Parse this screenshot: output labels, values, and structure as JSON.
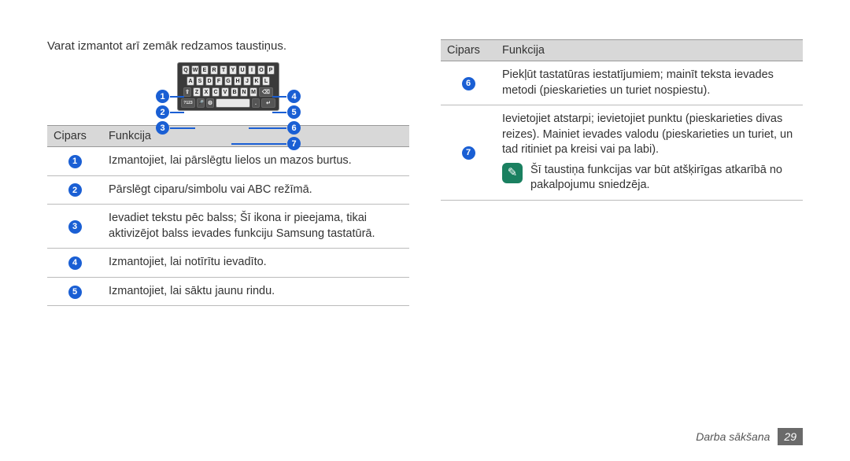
{
  "intro": "Varat izmantot arī zemāk redzamos taustiņus.",
  "headers": {
    "num": "Cipars",
    "func": "Funkcija"
  },
  "left_rows": [
    {
      "n": "1",
      "text": "Izmantojiet, lai pārslēgtu lielos un mazos burtus."
    },
    {
      "n": "2",
      "text": "Pārslēgt ciparu/simbolu vai ABC režīmā."
    },
    {
      "n": "3",
      "text": "Ievadiet tekstu pēc balss; Šī ikona ir pieejama, tikai aktivizējot balss ievades funkciju Samsung tastatūrā."
    },
    {
      "n": "4",
      "text": "Izmantojiet, lai notīrītu ievadīto."
    },
    {
      "n": "5",
      "text": "Izmantojiet, lai sāktu jaunu rindu."
    }
  ],
  "right_rows": [
    {
      "n": "6",
      "text": "Piekļūt tastatūras iestatījumiem; mainīt teksta ievades metodi (pieskarieties un turiet nospiestu)."
    },
    {
      "n": "7",
      "text": "Ievietojiet atstarpi; ievietojiet punktu (pieskarieties divas reizes). Mainiet ievades valodu (pieskarieties un turiet, un tad ritiniet pa kreisi vai pa labi).",
      "note": "Šī taustiņa funkcijas var būt atšķirīgas atkarībā no pakalpojumu sniedzēja."
    }
  ],
  "callouts": [
    "1",
    "2",
    "3",
    "4",
    "5",
    "6",
    "7"
  ],
  "footer": {
    "section": "Darba sākšana",
    "page": "29"
  }
}
